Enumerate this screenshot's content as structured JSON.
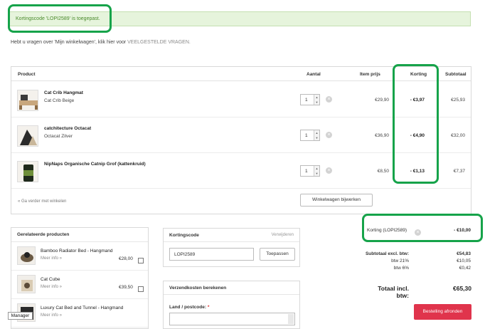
{
  "notice": {
    "text": "Kortingscode 'LOPI2589' is toegepast."
  },
  "help": {
    "text": "Hebt u vragen over 'Mijn winkelwagen', klik hier voor ",
    "link": "VEELGESTELDE VRAGEN."
  },
  "cart": {
    "headers": {
      "product": "Product",
      "qty": "Aantal",
      "item_price": "Item prijs",
      "discount": "Korting",
      "subtotal": "Subtotaal"
    },
    "rows": [
      {
        "name": "Cat Crib Hangmat",
        "variant": "Cat Crib Beige",
        "qty": "1",
        "price": "€29,90",
        "discount": "- €3,97",
        "subtotal": "€25,93"
      },
      {
        "name": "catchitecture Octacat",
        "variant": "Octacat Zilver",
        "qty": "1",
        "price": "€36,90",
        "discount": "- €4,90",
        "subtotal": "€32,00"
      },
      {
        "name": "NipNaps Organische Catnip Grof (kattenkruid)",
        "variant": "",
        "qty": "1",
        "price": "€8,50",
        "discount": "- €1,13",
        "subtotal": "€7,37"
      }
    ],
    "back_link": "« Ga verder met winkelen",
    "update_button": "Winkelwagen bijwerken"
  },
  "related": {
    "title": "Gerelateerde producten",
    "items": [
      {
        "name": "Bamboo Radiator Bed - Hangmand",
        "more": "Meer info »",
        "price": "€28,00"
      },
      {
        "name": "Cat Cube",
        "more": "Meer info »",
        "price": "€39,50"
      },
      {
        "name": "Luxury Cat Bed and Tunnel - Hangmand",
        "more": "Meer info »",
        "price": ""
      }
    ]
  },
  "coupon": {
    "title": "Kortingscode",
    "remove": "Verwijderen",
    "value": "LOPI2589",
    "apply": "Toepassen"
  },
  "shipping": {
    "title": "Verzendkosten berekenen",
    "label": "Land / postcode:",
    "required": "*"
  },
  "totals": {
    "discount_label": "Korting (LOPI2589)",
    "discount_value": "- €10,00",
    "excl_label": "Subtotaal excl. btw:",
    "excl_value": "€54,83",
    "vat21_label": "btw 21%",
    "vat21_value": "€10,05",
    "vat6_label": "btw 6%",
    "vat6_value": "€0,42",
    "total_label": "Totaal incl. btw:",
    "total_value": "€65,30",
    "order_button": "Bestelling afronden"
  },
  "manager": {
    "label": "Manager"
  },
  "colors": {
    "accent_highlight": "#16a34a",
    "order_button": "#e0344c",
    "success_bg": "#e6f4dc",
    "success_text": "#4a8a2c"
  }
}
